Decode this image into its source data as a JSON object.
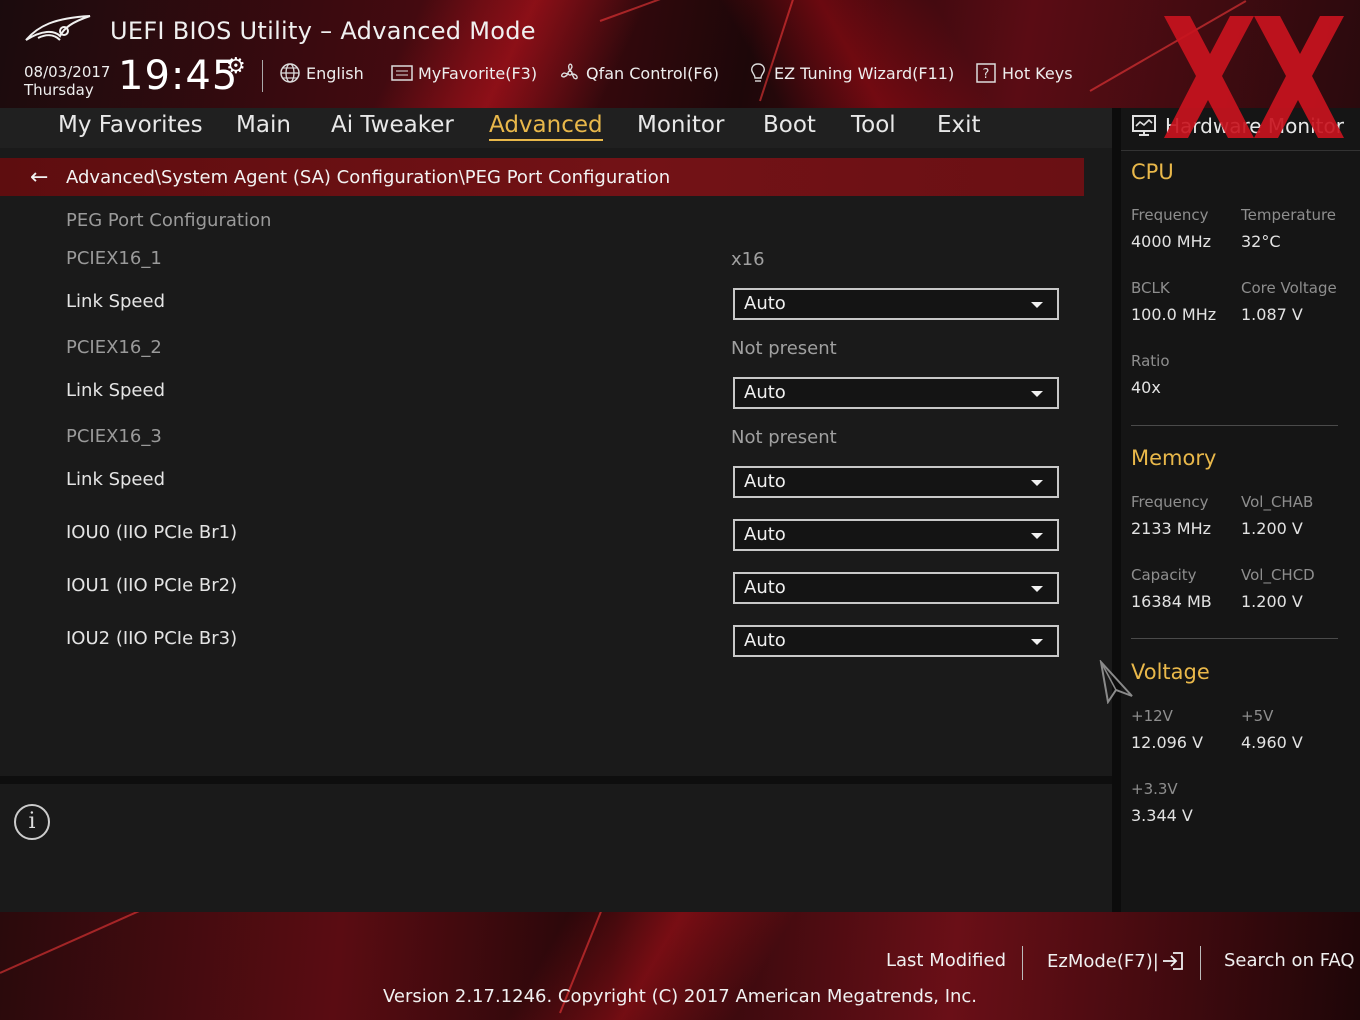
{
  "header": {
    "app_title": "UEFI BIOS Utility – Advanced Mode",
    "date": "08/03/2017",
    "day": "Thursday",
    "time": "19:45",
    "tools": {
      "language": "English",
      "my_favorite": "MyFavorite(F3)",
      "qfan": "Qfan Control(F6)",
      "ez_tuning": "EZ Tuning Wizard(F11)",
      "hot_keys": "Hot Keys"
    }
  },
  "nav": {
    "tabs": [
      "My Favorites",
      "Main",
      "Ai Tweaker",
      "Advanced",
      "Monitor",
      "Boot",
      "Tool",
      "Exit"
    ],
    "active": "Advanced"
  },
  "breadcrumb": "Advanced\\System Agent (SA) Configuration\\PEG Port Configuration",
  "settings": {
    "section_title": "PEG Port Configuration",
    "rows": [
      {
        "label": "PCIEX16_1",
        "value": "x16"
      },
      {
        "label": "Link Speed",
        "value": "Auto"
      },
      {
        "label": "PCIEX16_2",
        "value": "Not present"
      },
      {
        "label": "Link Speed",
        "value": "Auto"
      },
      {
        "label": "PCIEX16_3",
        "value": "Not present"
      },
      {
        "label": "Link Speed",
        "value": "Auto"
      },
      {
        "label": "IOU0 (IIO PCIe Br1)",
        "value": "Auto"
      },
      {
        "label": "IOU1 (IIO PCIe Br2)",
        "value": "Auto"
      },
      {
        "label": "IOU2 (IIO PCIe Br3)",
        "value": "Auto"
      }
    ]
  },
  "hardware_monitor": {
    "title": "Hardware Monitor",
    "cpu": {
      "heading": "CPU",
      "frequency_label": "Frequency",
      "frequency": "4000 MHz",
      "temperature_label": "Temperature",
      "temperature": "32°C",
      "bclk_label": "BCLK",
      "bclk": "100.0 MHz",
      "core_voltage_label": "Core Voltage",
      "core_voltage": "1.087 V",
      "ratio_label": "Ratio",
      "ratio": "40x"
    },
    "memory": {
      "heading": "Memory",
      "frequency_label": "Frequency",
      "frequency": "2133 MHz",
      "vol_chab_label": "Vol_CHAB",
      "vol_chab": "1.200 V",
      "capacity_label": "Capacity",
      "capacity": "16384 MB",
      "vol_chcd_label": "Vol_CHCD",
      "vol_chcd": "1.200 V"
    },
    "voltage": {
      "heading": "Voltage",
      "v12_label": "+12V",
      "v12": "12.096 V",
      "v5_label": "+5V",
      "v5": "4.960 V",
      "v33_label": "+3.3V",
      "v33": "3.344 V"
    }
  },
  "footer": {
    "last_modified": "Last Modified",
    "ezmode": "EzMode(F7)|",
    "search_faq": "Search on FAQ",
    "version": "Version 2.17.1246. Copyright (C) 2017 American Megatrends, Inc."
  },
  "colors": {
    "accent": "#e9b84a",
    "breadcrumb_red": "#731216",
    "watermark_red": "#c8141e"
  }
}
